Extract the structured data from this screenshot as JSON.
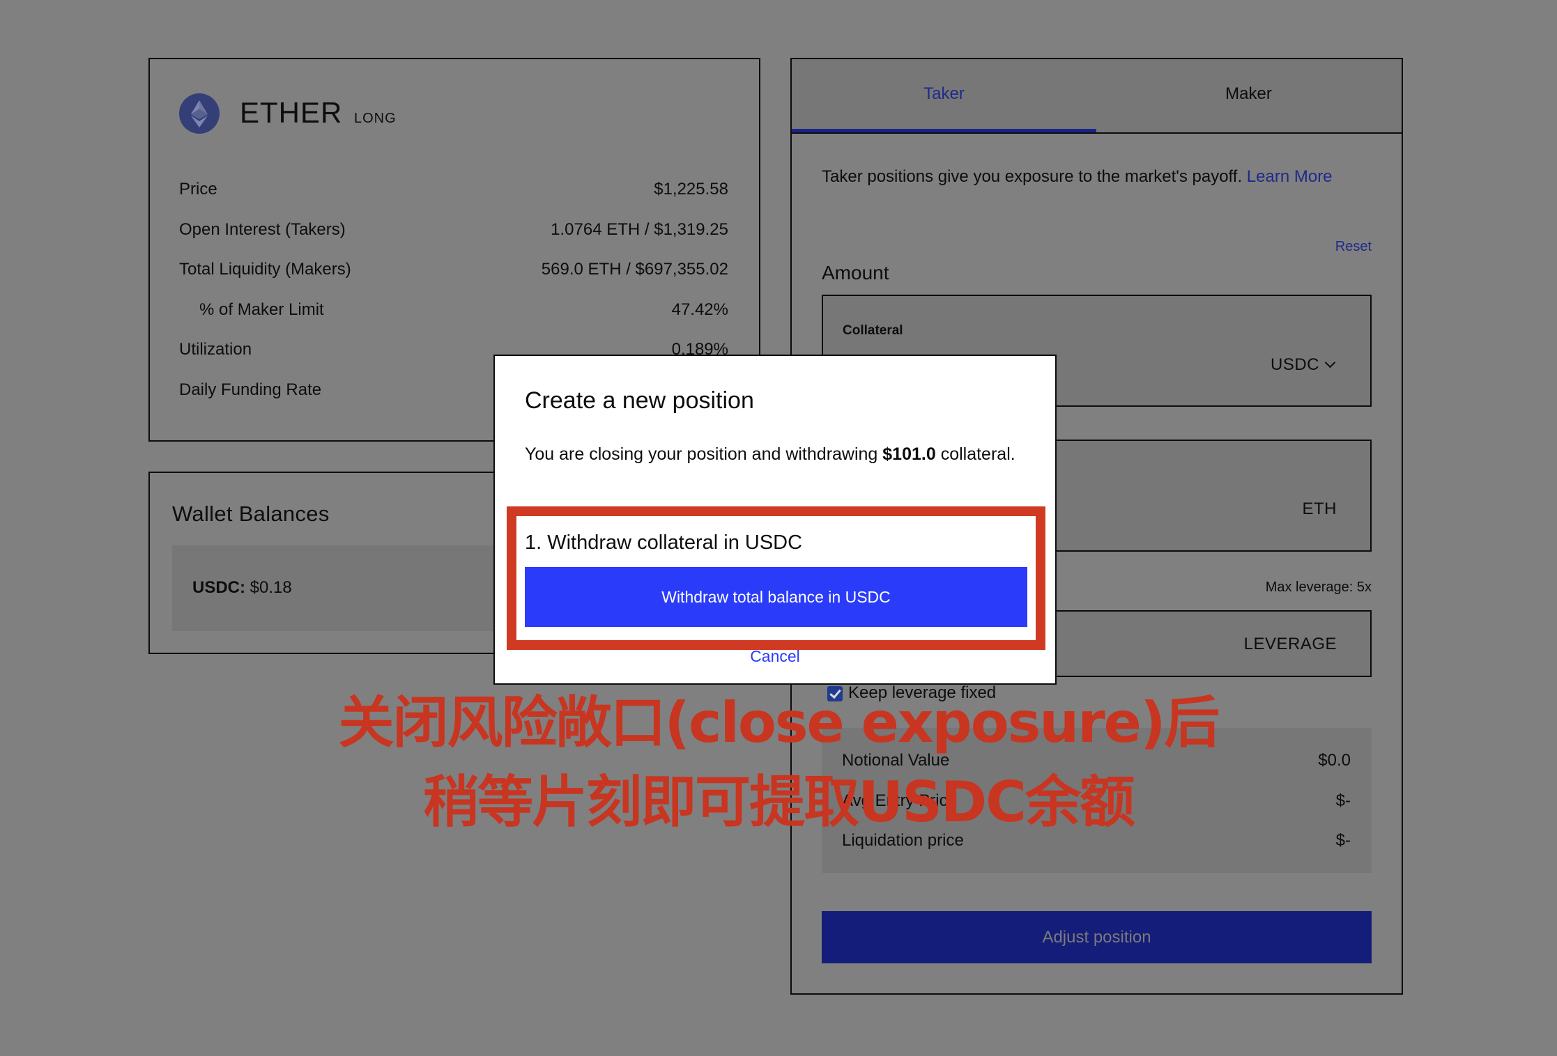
{
  "market": {
    "asset_name": "ETHER",
    "side": "LONG",
    "logo_icon": "ethereum-icon",
    "logo_color": "#343f78",
    "stats": [
      {
        "label": "Price",
        "value": "$1,225.58",
        "indent": false
      },
      {
        "label": "Open Interest (Takers)",
        "value": "1.0764 ETH / $1,319.25",
        "indent": false
      },
      {
        "label": "Total Liquidity (Makers)",
        "value": "569.0 ETH / $697,355.02",
        "indent": false
      },
      {
        "label": "% of Maker Limit",
        "value": "47.42%",
        "indent": true
      },
      {
        "label": "Utilization",
        "value": "0.189%",
        "indent": false
      },
      {
        "label": "Daily Funding Rate",
        "value": "",
        "indent": false
      }
    ]
  },
  "wallet": {
    "title": "Wallet Balances",
    "items": [
      {
        "token": "USDC:",
        "amount": "$0.18"
      }
    ]
  },
  "trade": {
    "tabs": [
      {
        "label": "Taker",
        "active": true
      },
      {
        "label": "Maker",
        "active": false
      }
    ],
    "description": "Taker positions give you exposure to the market's payoff. ",
    "learn_more": "Learn More",
    "reset": "Reset",
    "amount_title": "Amount",
    "collateral_label": "Collateral",
    "collateral_token": "USDC",
    "position_unit": "ETH",
    "max_leverage": "Max leverage: 5x",
    "leverage_placeholder": "LEVERAGE",
    "keep_leverage_label": "Keep leverage fixed",
    "keep_leverage_checked": true,
    "summary": [
      {
        "label": "Notional Value",
        "value": "$0.0"
      },
      {
        "label": "Avg Entry Price",
        "value": "$-"
      },
      {
        "label": "Liquidation price",
        "value": "$-"
      }
    ],
    "adjust_button": "Adjust position"
  },
  "modal": {
    "title": "Create a new position",
    "body_prefix": "You are closing your position and withdrawing ",
    "body_amount": "$101.0",
    "body_suffix": " collateral.",
    "step_title": "1. Withdraw collateral in USDC",
    "withdraw_button": "Withdraw total balance in USDC",
    "cancel": "Cancel",
    "accent_color": "#2b3bfa"
  },
  "annotation": {
    "line1": "关闭风险敞口(close exposure)后",
    "line2": "稍等片刻即可提取USDC余额",
    "color": "#c83520",
    "highlight_color": "#d13a22"
  }
}
